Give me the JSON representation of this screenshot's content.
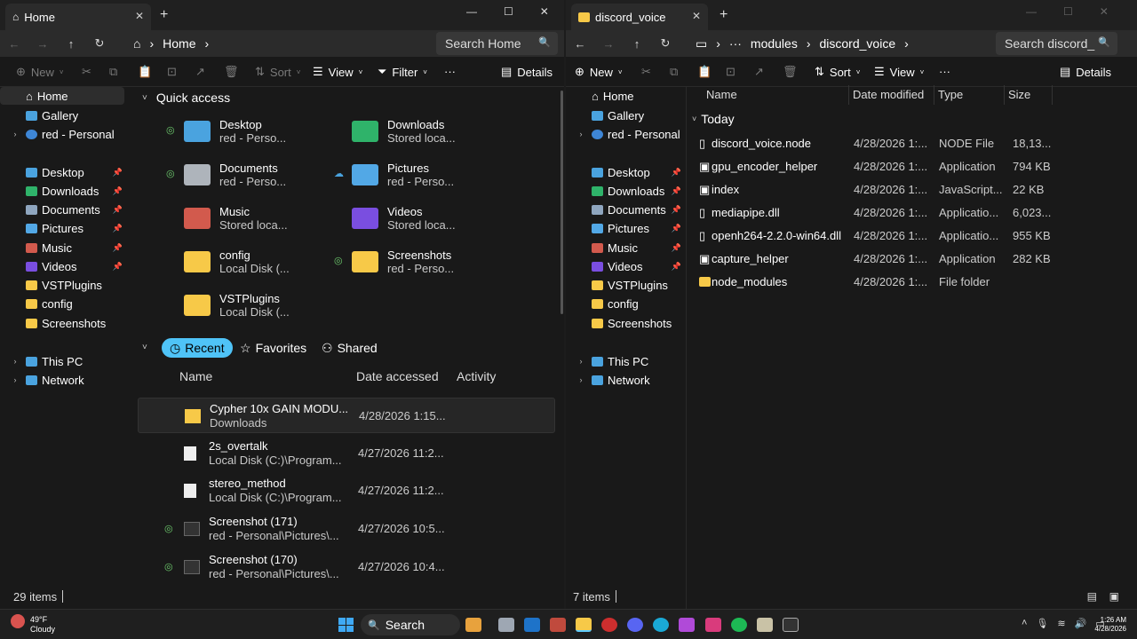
{
  "left": {
    "tab_title": "Home",
    "address": [
      "Home"
    ],
    "search_placeholder": "Search Home",
    "cmd": {
      "new": "New",
      "sort": "Sort",
      "view": "View",
      "filter": "Filter",
      "more": "···",
      "details": "Details"
    },
    "sidebar": {
      "top": [
        "Home",
        "Gallery",
        "red - Personal"
      ],
      "pinned": [
        "Desktop",
        "Downloads",
        "Documents",
        "Pictures",
        "Music",
        "Videos",
        "VSTPlugins",
        "config",
        "Screenshots"
      ],
      "bottom": [
        "This PC",
        "Network"
      ]
    },
    "quick_access_title": "Quick access",
    "quick_access": [
      {
        "name": "Desktop",
        "sub": "red - Perso..."
      },
      {
        "name": "Downloads",
        "sub": "Stored loca..."
      },
      {
        "name": "Documents",
        "sub": "red - Perso..."
      },
      {
        "name": "Pictures",
        "sub": "red - Perso..."
      },
      {
        "name": "Music",
        "sub": "Stored loca..."
      },
      {
        "name": "Videos",
        "sub": "Stored loca..."
      },
      {
        "name": "config",
        "sub": "Local Disk (..."
      },
      {
        "name": "Screenshots",
        "sub": "red - Perso..."
      },
      {
        "name": "VSTPlugins",
        "sub": "Local Disk (..."
      }
    ],
    "chips": [
      "Recent",
      "Favorites",
      "Shared"
    ],
    "columns": [
      "Name",
      "Date accessed",
      "Activity"
    ],
    "recent": [
      {
        "name": "Cypher 10x GAIN MODU...",
        "sub": "Downloads",
        "date": "4/28/2026 1:15..."
      },
      {
        "name": "2s_overtalk",
        "sub": "Local Disk (C:)\\Program...",
        "date": "4/27/2026 11:2..."
      },
      {
        "name": "stereo_method",
        "sub": "Local Disk (C:)\\Program...",
        "date": "4/27/2026 11:2..."
      },
      {
        "name": "Screenshot (171)",
        "sub": "red - Personal\\Pictures\\...",
        "date": "4/27/2026 10:5..."
      },
      {
        "name": "Screenshot (170)",
        "sub": "red - Personal\\Pictures\\...",
        "date": "4/27/2026 10:4..."
      }
    ],
    "status": "29 items"
  },
  "right": {
    "tab_title": "discord_voice",
    "address": [
      "···",
      "modules",
      "discord_voice"
    ],
    "search_placeholder": "Search discord_",
    "cmd": {
      "new": "New",
      "sort": "Sort",
      "view": "View",
      "more": "···",
      "details": "Details"
    },
    "sidebar": {
      "top": [
        "Home",
        "Gallery",
        "red - Personal"
      ],
      "pinned": [
        "Desktop",
        "Downloads",
        "Documents",
        "Pictures",
        "Music",
        "Videos",
        "VSTPlugins",
        "config",
        "Screenshots"
      ],
      "bottom": [
        "This PC",
        "Network"
      ]
    },
    "columns": [
      "Name",
      "Date modified",
      "Type",
      "Size"
    ],
    "group": "Today",
    "files": [
      {
        "name": "discord_voice.node",
        "date": "4/28/2026 1:...",
        "type": "NODE File",
        "size": "18,13..."
      },
      {
        "name": "gpu_encoder_helper",
        "date": "4/28/2026 1:...",
        "type": "Application",
        "size": "794 KB"
      },
      {
        "name": "index",
        "date": "4/28/2026 1:...",
        "type": "JavaScript...",
        "size": "22 KB"
      },
      {
        "name": "mediapipe.dll",
        "date": "4/28/2026 1:...",
        "type": "Applicatio...",
        "size": "6,023..."
      },
      {
        "name": "openh264-2.2.0-win64.dll",
        "date": "4/28/2026 1:...",
        "type": "Applicatio...",
        "size": "955 KB"
      },
      {
        "name": "capture_helper",
        "date": "4/28/2026 1:...",
        "type": "Application",
        "size": "282 KB"
      },
      {
        "name": "node_modules",
        "date": "4/28/2026 1:...",
        "type": "File folder",
        "size": ""
      }
    ],
    "status": "7 items"
  },
  "taskbar": {
    "weather_temp": "49°F",
    "weather_cond": "Cloudy",
    "search": "Search",
    "time": "1:26 AM",
    "date": "4/28/2026"
  }
}
